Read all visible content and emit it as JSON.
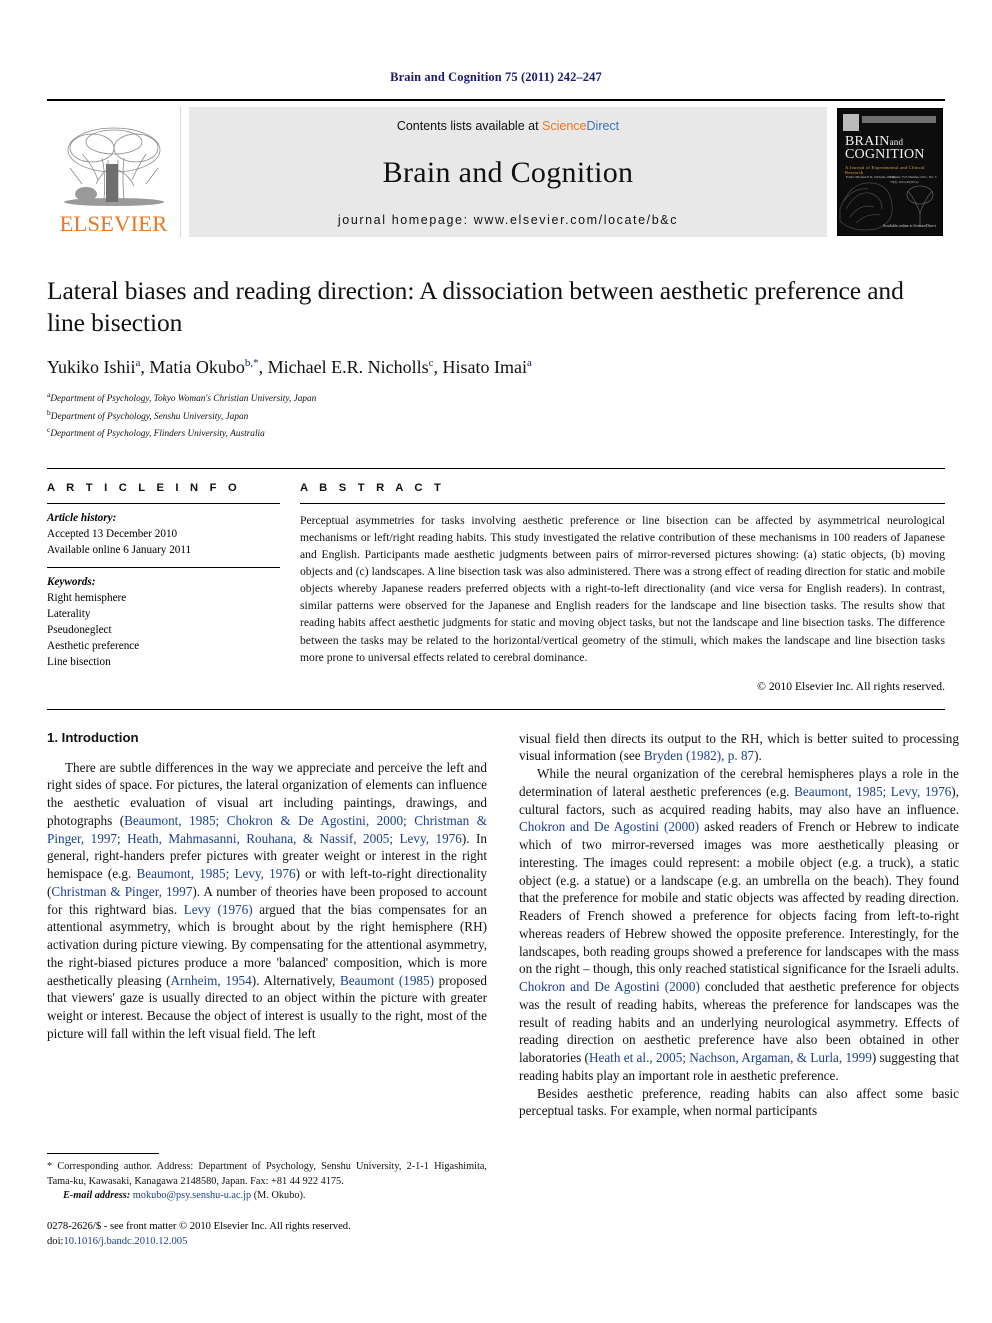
{
  "running_head": "Brain and Cognition 75 (2011) 242–247",
  "masthead": {
    "publisher_logo_text": "ELSEVIER",
    "contents_prefix": "Contents lists available at ",
    "sciencedirect_science": "Science",
    "sciencedirect_direct": "Direct",
    "journal_name": "Brain and Cognition",
    "homepage": "journal homepage: www.elsevier.com/locate/b&c",
    "cover": {
      "title_line1": "BRAIN",
      "title_and": "and",
      "title_line2": "COGNITION",
      "subtitle": "A Journal of Experimental and Clinical Research",
      "meta_left": "Editor\nMichael E.R. Nicholls, Ph.D.",
      "meta_right": "Volume 75/3\nNumber 2011, Vol. 3\n75(3) 123-247(2011)",
      "footer": "Available online at\nScienceDirect"
    }
  },
  "article": {
    "title": "Lateral biases and reading direction: A dissociation between aesthetic preference and line bisection",
    "authors": [
      {
        "name": "Yukiko Ishii",
        "sup": "a"
      },
      {
        "name": "Matia Okubo",
        "sup": "b,*"
      },
      {
        "name": "Michael E.R. Nicholls",
        "sup": "c"
      },
      {
        "name": "Hisato Imai",
        "sup": "a"
      }
    ],
    "authors_line": "Yukiko Ishii a, Matia Okubo b,*, Michael E.R. Nicholls c, Hisato Imai a",
    "affiliations": [
      {
        "sup": "a",
        "text": "Department of Psychology, Tokyo Woman's Christian University, Japan"
      },
      {
        "sup": "b",
        "text": "Department of Psychology, Senshu University, Japan"
      },
      {
        "sup": "c",
        "text": "Department of Psychology, Flinders University, Australia"
      }
    ]
  },
  "article_info": {
    "heading": "A R T I C L E    I N F O",
    "history_label": "Article history:",
    "history_lines": [
      "Accepted 13 December 2010",
      "Available online 6 January 2011"
    ],
    "keywords_label": "Keywords:",
    "keywords": [
      "Right hemisphere",
      "Laterality",
      "Pseudoneglect",
      "Aesthetic preference",
      "Line bisection"
    ]
  },
  "abstract": {
    "heading": "A B S T R A C T",
    "text": "Perceptual asymmetries for tasks involving aesthetic preference or line bisection can be affected by asymmetrical neurological mechanisms or left/right reading habits. This study investigated the relative contribution of these mechanisms in 100 readers of Japanese and English. Participants made aesthetic judgments between pairs of mirror-reversed pictures showing: (a) static objects, (b) moving objects and (c) landscapes. A line bisection task was also administered. There was a strong effect of reading direction for static and mobile objects whereby Japanese readers preferred objects with a right-to-left directionality (and vice versa for English readers). In contrast, similar patterns were observed for the Japanese and English readers for the landscape and line bisection tasks. The results show that reading habits affect aesthetic judgments for static and moving object tasks, but not the landscape and line bisection tasks. The difference between the tasks may be related to the horizontal/vertical geometry of the stimuli, which makes the landscape and line bisection tasks more prone to universal effects related to cerebral dominance.",
    "copyright": "© 2010 Elsevier Inc. All rights reserved."
  },
  "introduction": {
    "heading": "1. Introduction",
    "left_paragraph_1_a": "There are subtle differences in the way we appreciate and perceive the left and right sides of space. For pictures, the lateral organization of elements can influence the aesthetic evaluation of visual art including paintings, drawings, and photographs (",
    "left_refs_1": "Beaumont, 1985; Chokron & De Agostini, 2000; Christman & Pinger, 1997; Heath, Mahmasanni, Rouhana, & Nassif, 2005; Levy, 1976",
    "left_paragraph_1_b": "). In general, right-handers prefer pictures with greater weight or interest in the right hemispace (e.g. ",
    "left_refs_2": "Beaumont, 1985; Levy, 1976",
    "left_paragraph_1_c": ") or with left-to-right directionality (",
    "left_refs_3": "Christman & Pinger, 1997",
    "left_paragraph_1_d": "). A number of theories have been proposed to account for this rightward bias. ",
    "left_refs_4": "Levy (1976)",
    "left_paragraph_1_e": " argued that the bias compensates for an attentional asymmetry, which is brought about by the right hemisphere (RH) activation during picture viewing. By compensating for the attentional asymmetry, the right-biased pictures produce a more 'balanced' composition, which is more aesthetically pleasing (",
    "left_refs_5": "Arnheim, 1954",
    "left_paragraph_1_f": "). Alternatively, ",
    "left_refs_6": "Beaumont (1985)",
    "left_paragraph_1_g": " proposed that viewers' gaze is usually directed to an object within the picture with greater weight or interest. Because the object of interest is usually to the right, most of the picture will fall within the left visual field. The left",
    "right_paragraph_0_a": "visual field then directs its output to the RH, which is better suited to processing visual information (see ",
    "right_refs_0": "Bryden (1982), p. 87",
    "right_paragraph_0_b": ").",
    "right_paragraph_1_a": "While the neural organization of the cerebral hemispheres plays a role in the determination of lateral aesthetic preferences (e.g. ",
    "right_refs_1": "Beaumont, 1985; Levy, 1976",
    "right_paragraph_1_b": "), cultural factors, such as acquired reading habits, may also have an influence. ",
    "right_refs_2": "Chokron and De Agostini (2000)",
    "right_paragraph_1_c": " asked readers of French or Hebrew to indicate which of two mirror-reversed images was more aesthetically pleasing or interesting. The images could represent: a mobile object (e.g. a truck), a static object (e.g. a statue) or a landscape (e.g. an umbrella on the beach). They found that the preference for mobile and static objects was affected by reading direction. Readers of French showed a preference for objects facing from left-to-right whereas readers of Hebrew showed the opposite preference. Interestingly, for the landscapes, both reading groups showed a preference for landscapes with the mass on the right – though, this only reached statistical significance for the Israeli adults. ",
    "right_refs_3": "Chokron and De Agostini (2000)",
    "right_paragraph_1_d": " concluded that aesthetic preference for objects was the result of reading habits, whereas the preference for landscapes was the result of reading habits and an underlying neurological asymmetry. Effects of reading direction on aesthetic preference have also been obtained in other laboratories (",
    "right_refs_4": "Heath et al., 2005; Nachson, Argaman, & Lurla, 1999",
    "right_paragraph_1_e": ") suggesting that reading habits play an important role in aesthetic preference.",
    "right_paragraph_2": "Besides aesthetic preference, reading habits can also affect some basic perceptual tasks. For example, when normal participants"
  },
  "footnote": {
    "marker": "*",
    "corresponding": " Corresponding author. Address: Department of Psychology, Senshu University, 2-1-1 Higashimita, Tama-ku, Kawasaki, Kanagawa 2148580, Japan. Fax: +81 44 922 4175.",
    "email_label": "E-mail address:",
    "email": "mokubo@psy.senshu-u.ac.jp",
    "email_owner": " (M. Okubo)."
  },
  "imprint": {
    "issn_line": "0278-2626/$ - see front matter © 2010 Elsevier Inc. All rights reserved.",
    "doi_label": "doi:",
    "doi": "10.1016/j.bandc.2010.12.005"
  },
  "colors": {
    "link_blue": "#1a3f8f",
    "running_head_blue": "#1a1a6e",
    "elsevier_orange": "#E87722",
    "sciencedirect_blue": "#3b6fc4",
    "masthead_gray": "#e8e8e8"
  }
}
